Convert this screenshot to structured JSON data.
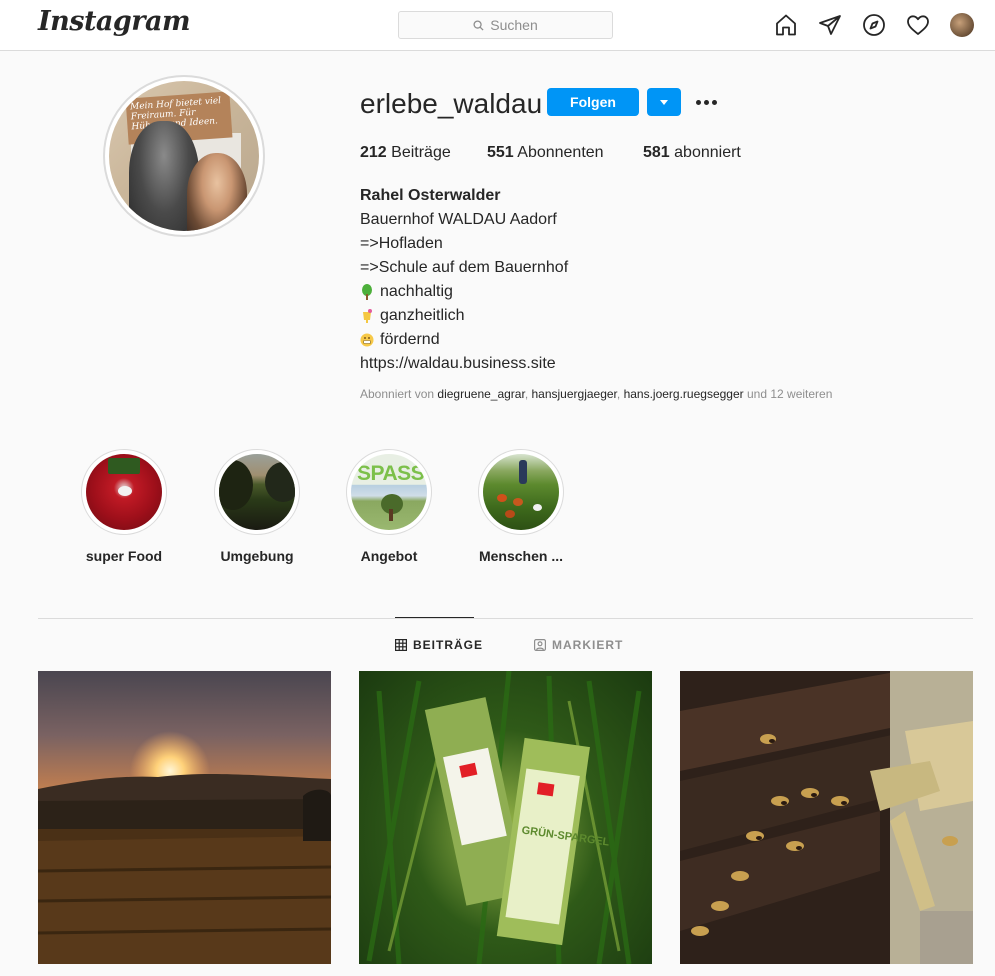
{
  "nav": {
    "logo": "Instagram",
    "search_placeholder": "Suchen",
    "icons": [
      "home-icon",
      "direct-message-icon",
      "explore-icon",
      "heart-icon",
      "profile-avatar"
    ]
  },
  "profile": {
    "username": "erlebe_waldau",
    "follow_label": "Folgen",
    "stats": {
      "posts_count": "212",
      "posts_label": "Beiträge",
      "followers_count": "551",
      "followers_label": "Abonnenten",
      "following_count": "581",
      "following_label": "abonniert"
    },
    "full_name": "Rahel Osterwalder",
    "bio_lines": [
      "Bauernhof WALDAU Aadorf",
      "=>Hofladen",
      "=>Schule auf dem Bauernhof",
      "nachhaltig",
      "ganzheitlich",
      "fördernd"
    ],
    "website": "https://waldau.business.site",
    "followed_by": {
      "prefix": "Abonniert von",
      "users": [
        "diegruene_agrar",
        "hansjuergjaeger",
        "hans.joerg.ruegsegger"
      ],
      "suffix": "und 12 weiteren"
    }
  },
  "highlights": [
    {
      "label": "super Food"
    },
    {
      "label": "Umgebung"
    },
    {
      "label": "Angebot",
      "image_text": "SPASS"
    },
    {
      "label": "Menschen ..."
    }
  ],
  "tabs": {
    "posts": "BEITRÄGE",
    "tagged": "MARKIERT"
  },
  "profile_pic_sign_text": "Mein Hof bietet viel Freiraum. Für Hühner und Ideen.",
  "posts": [
    {
      "subject": "sunset over field"
    },
    {
      "subject": "asparagus bundles",
      "package_text": "GRÜN-SPARGEL"
    },
    {
      "subject": "bees at hive"
    }
  ],
  "colors": {
    "accent": "#0095f6",
    "border": "#dbdbdb",
    "text": "#262626",
    "muted": "#8e8e8e",
    "background": "#fafafa"
  }
}
